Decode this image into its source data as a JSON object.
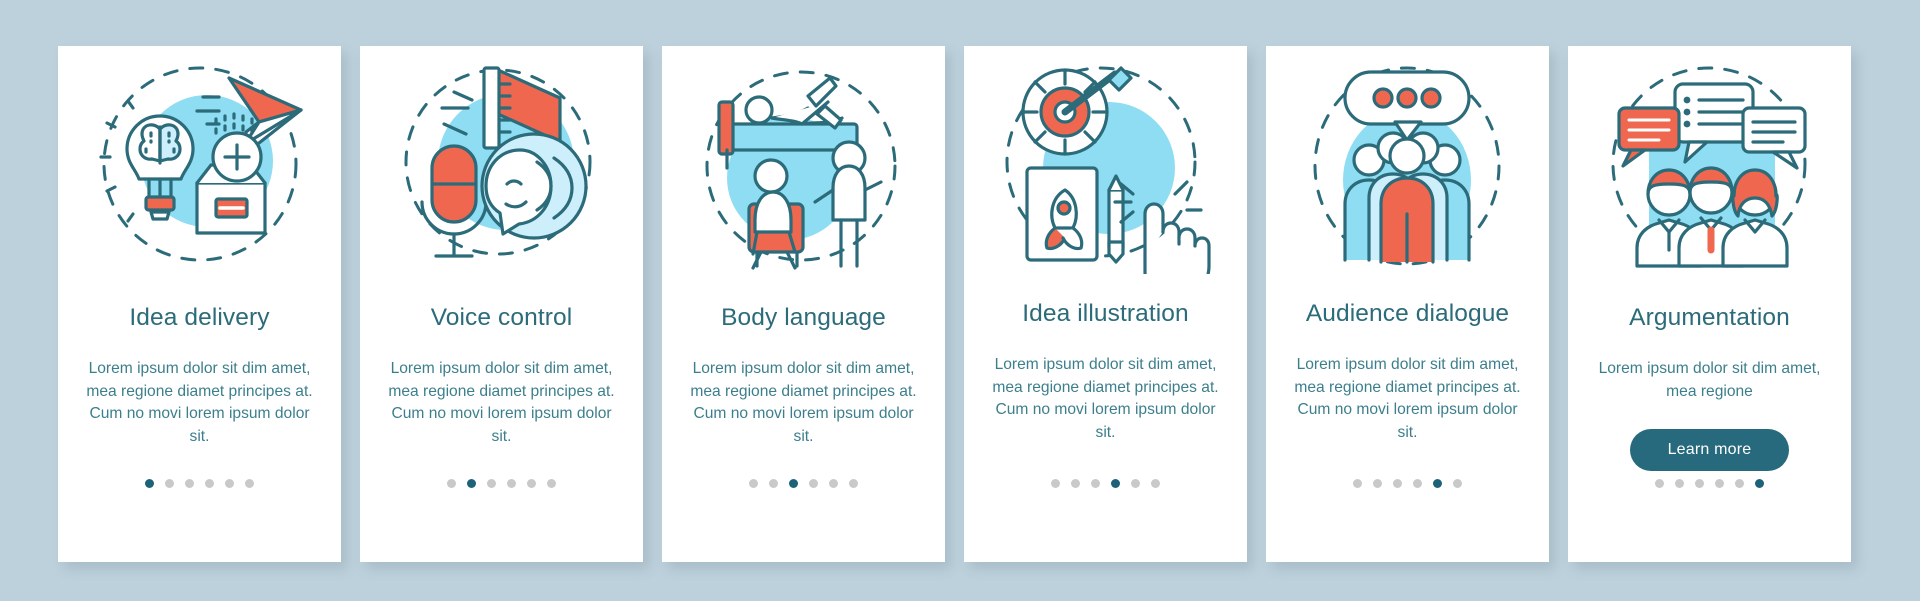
{
  "theme": {
    "page_background": "#bdd1dc",
    "card_background": "#ffffff",
    "title_color": "#2b6b7a",
    "body_color": "#3c7f8c",
    "accent_teal": "#2b7a8c",
    "accent_coral": "#f0674f",
    "accent_light_blue": "#8fddf3",
    "dot_active": "#1c6379",
    "dot_inactive": "#c9c9c9",
    "button_background": "#276a7d",
    "button_text": "#ffffff"
  },
  "screens": [
    {
      "icon": "lightbulb-brain-paper-plane-icon",
      "title": "Idea delivery",
      "body": "Lorem ipsum dolor sit dim amet, mea regione diamet principes at. Cum no movi lorem ipsum dolor sit.",
      "dots": {
        "count": 6,
        "active_index": 0
      },
      "has_button": false
    },
    {
      "icon": "megaphone-microphone-speaking-face-icon",
      "title": "Voice control",
      "body": "Lorem ipsum dolor sit dim amet, mea regione diamet principes at. Cum no movi lorem ipsum dolor sit.",
      "dots": {
        "count": 6,
        "active_index": 1
      },
      "has_button": false
    },
    {
      "icon": "people-posture-bed-chair-icon",
      "title": "Body language",
      "body": "Lorem ipsum dolor sit dim amet, mea regione diamet principes at. Cum no movi lorem ipsum dolor sit.",
      "dots": {
        "count": 6,
        "active_index": 2
      },
      "has_button": false
    },
    {
      "icon": "target-dart-rocket-sketch-hand-icon",
      "title": "Idea illustration",
      "body": "Lorem ipsum dolor sit dim amet, mea regione diamet principes at. Cum no movi lorem ipsum dolor sit.",
      "dots": {
        "count": 6,
        "active_index": 3
      },
      "has_button": false
    },
    {
      "icon": "audience-crowd-speech-bubble-icon",
      "title": "Audience dialogue",
      "body": "Lorem ipsum dolor sit dim amet, mea regione diamet principes at. Cum no movi lorem ipsum dolor sit.",
      "dots": {
        "count": 6,
        "active_index": 4
      },
      "has_button": false
    },
    {
      "icon": "three-people-chat-bubbles-icon",
      "title": "Argumentation",
      "body": "Lorem ipsum dolor sit dim amet, mea regione",
      "dots": {
        "count": 6,
        "active_index": 5
      },
      "has_button": true,
      "button_label": "Learn more"
    }
  ]
}
